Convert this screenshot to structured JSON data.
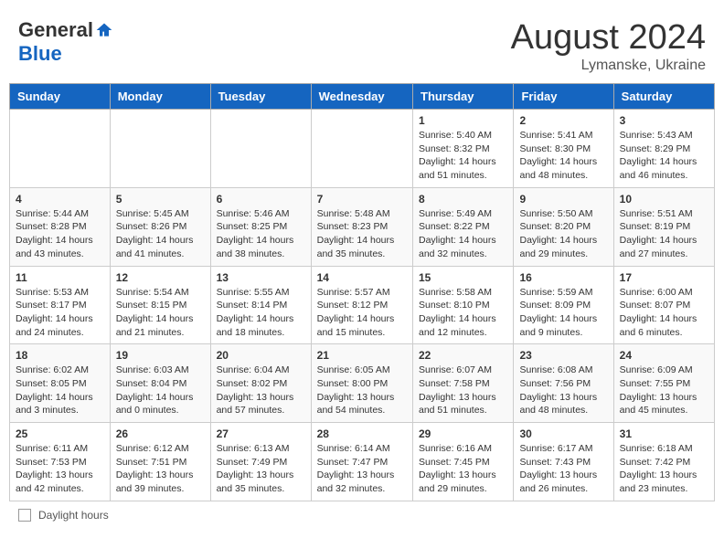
{
  "header": {
    "logo_general": "General",
    "logo_blue": "Blue",
    "month_title": "August 2024",
    "location": "Lymanske, Ukraine"
  },
  "footer": {
    "daylight_label": "Daylight hours"
  },
  "calendar": {
    "headers": [
      "Sunday",
      "Monday",
      "Tuesday",
      "Wednesday",
      "Thursday",
      "Friday",
      "Saturday"
    ],
    "weeks": [
      [
        {
          "day": "",
          "info": ""
        },
        {
          "day": "",
          "info": ""
        },
        {
          "day": "",
          "info": ""
        },
        {
          "day": "",
          "info": ""
        },
        {
          "day": "1",
          "info": "Sunrise: 5:40 AM\nSunset: 8:32 PM\nDaylight: 14 hours\nand 51 minutes."
        },
        {
          "day": "2",
          "info": "Sunrise: 5:41 AM\nSunset: 8:30 PM\nDaylight: 14 hours\nand 48 minutes."
        },
        {
          "day": "3",
          "info": "Sunrise: 5:43 AM\nSunset: 8:29 PM\nDaylight: 14 hours\nand 46 minutes."
        }
      ],
      [
        {
          "day": "4",
          "info": "Sunrise: 5:44 AM\nSunset: 8:28 PM\nDaylight: 14 hours\nand 43 minutes."
        },
        {
          "day": "5",
          "info": "Sunrise: 5:45 AM\nSunset: 8:26 PM\nDaylight: 14 hours\nand 41 minutes."
        },
        {
          "day": "6",
          "info": "Sunrise: 5:46 AM\nSunset: 8:25 PM\nDaylight: 14 hours\nand 38 minutes."
        },
        {
          "day": "7",
          "info": "Sunrise: 5:48 AM\nSunset: 8:23 PM\nDaylight: 14 hours\nand 35 minutes."
        },
        {
          "day": "8",
          "info": "Sunrise: 5:49 AM\nSunset: 8:22 PM\nDaylight: 14 hours\nand 32 minutes."
        },
        {
          "day": "9",
          "info": "Sunrise: 5:50 AM\nSunset: 8:20 PM\nDaylight: 14 hours\nand 29 minutes."
        },
        {
          "day": "10",
          "info": "Sunrise: 5:51 AM\nSunset: 8:19 PM\nDaylight: 14 hours\nand 27 minutes."
        }
      ],
      [
        {
          "day": "11",
          "info": "Sunrise: 5:53 AM\nSunset: 8:17 PM\nDaylight: 14 hours\nand 24 minutes."
        },
        {
          "day": "12",
          "info": "Sunrise: 5:54 AM\nSunset: 8:15 PM\nDaylight: 14 hours\nand 21 minutes."
        },
        {
          "day": "13",
          "info": "Sunrise: 5:55 AM\nSunset: 8:14 PM\nDaylight: 14 hours\nand 18 minutes."
        },
        {
          "day": "14",
          "info": "Sunrise: 5:57 AM\nSunset: 8:12 PM\nDaylight: 14 hours\nand 15 minutes."
        },
        {
          "day": "15",
          "info": "Sunrise: 5:58 AM\nSunset: 8:10 PM\nDaylight: 14 hours\nand 12 minutes."
        },
        {
          "day": "16",
          "info": "Sunrise: 5:59 AM\nSunset: 8:09 PM\nDaylight: 14 hours\nand 9 minutes."
        },
        {
          "day": "17",
          "info": "Sunrise: 6:00 AM\nSunset: 8:07 PM\nDaylight: 14 hours\nand 6 minutes."
        }
      ],
      [
        {
          "day": "18",
          "info": "Sunrise: 6:02 AM\nSunset: 8:05 PM\nDaylight: 14 hours\nand 3 minutes."
        },
        {
          "day": "19",
          "info": "Sunrise: 6:03 AM\nSunset: 8:04 PM\nDaylight: 14 hours\nand 0 minutes."
        },
        {
          "day": "20",
          "info": "Sunrise: 6:04 AM\nSunset: 8:02 PM\nDaylight: 13 hours\nand 57 minutes."
        },
        {
          "day": "21",
          "info": "Sunrise: 6:05 AM\nSunset: 8:00 PM\nDaylight: 13 hours\nand 54 minutes."
        },
        {
          "day": "22",
          "info": "Sunrise: 6:07 AM\nSunset: 7:58 PM\nDaylight: 13 hours\nand 51 minutes."
        },
        {
          "day": "23",
          "info": "Sunrise: 6:08 AM\nSunset: 7:56 PM\nDaylight: 13 hours\nand 48 minutes."
        },
        {
          "day": "24",
          "info": "Sunrise: 6:09 AM\nSunset: 7:55 PM\nDaylight: 13 hours\nand 45 minutes."
        }
      ],
      [
        {
          "day": "25",
          "info": "Sunrise: 6:11 AM\nSunset: 7:53 PM\nDaylight: 13 hours\nand 42 minutes."
        },
        {
          "day": "26",
          "info": "Sunrise: 6:12 AM\nSunset: 7:51 PM\nDaylight: 13 hours\nand 39 minutes."
        },
        {
          "day": "27",
          "info": "Sunrise: 6:13 AM\nSunset: 7:49 PM\nDaylight: 13 hours\nand 35 minutes."
        },
        {
          "day": "28",
          "info": "Sunrise: 6:14 AM\nSunset: 7:47 PM\nDaylight: 13 hours\nand 32 minutes."
        },
        {
          "day": "29",
          "info": "Sunrise: 6:16 AM\nSunset: 7:45 PM\nDaylight: 13 hours\nand 29 minutes."
        },
        {
          "day": "30",
          "info": "Sunrise: 6:17 AM\nSunset: 7:43 PM\nDaylight: 13 hours\nand 26 minutes."
        },
        {
          "day": "31",
          "info": "Sunrise: 6:18 AM\nSunset: 7:42 PM\nDaylight: 13 hours\nand 23 minutes."
        }
      ]
    ]
  }
}
